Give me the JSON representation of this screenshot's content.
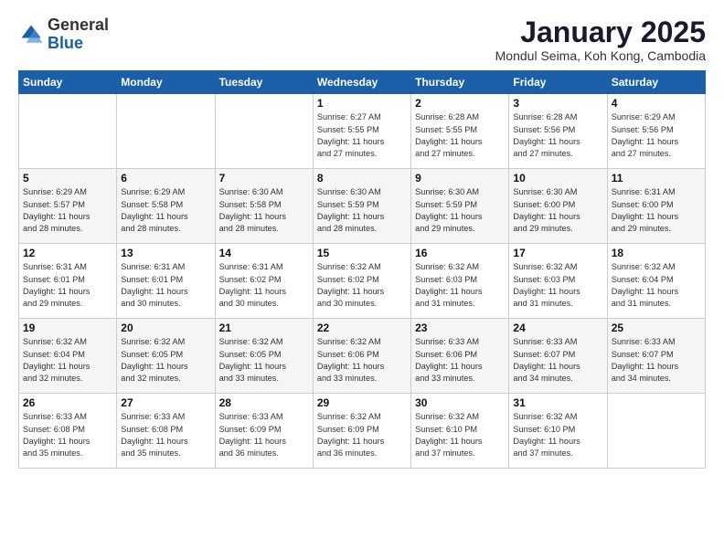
{
  "logo": {
    "line1": "General",
    "line2": "Blue"
  },
  "title": "January 2025",
  "location": "Mondul Seima, Koh Kong, Cambodia",
  "weekdays": [
    "Sunday",
    "Monday",
    "Tuesday",
    "Wednesday",
    "Thursday",
    "Friday",
    "Saturday"
  ],
  "weeks": [
    [
      {
        "day": "",
        "info": ""
      },
      {
        "day": "",
        "info": ""
      },
      {
        "day": "",
        "info": ""
      },
      {
        "day": "1",
        "info": "Sunrise: 6:27 AM\nSunset: 5:55 PM\nDaylight: 11 hours\nand 27 minutes."
      },
      {
        "day": "2",
        "info": "Sunrise: 6:28 AM\nSunset: 5:55 PM\nDaylight: 11 hours\nand 27 minutes."
      },
      {
        "day": "3",
        "info": "Sunrise: 6:28 AM\nSunset: 5:56 PM\nDaylight: 11 hours\nand 27 minutes."
      },
      {
        "day": "4",
        "info": "Sunrise: 6:29 AM\nSunset: 5:56 PM\nDaylight: 11 hours\nand 27 minutes."
      }
    ],
    [
      {
        "day": "5",
        "info": "Sunrise: 6:29 AM\nSunset: 5:57 PM\nDaylight: 11 hours\nand 28 minutes."
      },
      {
        "day": "6",
        "info": "Sunrise: 6:29 AM\nSunset: 5:58 PM\nDaylight: 11 hours\nand 28 minutes."
      },
      {
        "day": "7",
        "info": "Sunrise: 6:30 AM\nSunset: 5:58 PM\nDaylight: 11 hours\nand 28 minutes."
      },
      {
        "day": "8",
        "info": "Sunrise: 6:30 AM\nSunset: 5:59 PM\nDaylight: 11 hours\nand 28 minutes."
      },
      {
        "day": "9",
        "info": "Sunrise: 6:30 AM\nSunset: 5:59 PM\nDaylight: 11 hours\nand 29 minutes."
      },
      {
        "day": "10",
        "info": "Sunrise: 6:30 AM\nSunset: 6:00 PM\nDaylight: 11 hours\nand 29 minutes."
      },
      {
        "day": "11",
        "info": "Sunrise: 6:31 AM\nSunset: 6:00 PM\nDaylight: 11 hours\nand 29 minutes."
      }
    ],
    [
      {
        "day": "12",
        "info": "Sunrise: 6:31 AM\nSunset: 6:01 PM\nDaylight: 11 hours\nand 29 minutes."
      },
      {
        "day": "13",
        "info": "Sunrise: 6:31 AM\nSunset: 6:01 PM\nDaylight: 11 hours\nand 30 minutes."
      },
      {
        "day": "14",
        "info": "Sunrise: 6:31 AM\nSunset: 6:02 PM\nDaylight: 11 hours\nand 30 minutes."
      },
      {
        "day": "15",
        "info": "Sunrise: 6:32 AM\nSunset: 6:02 PM\nDaylight: 11 hours\nand 30 minutes."
      },
      {
        "day": "16",
        "info": "Sunrise: 6:32 AM\nSunset: 6:03 PM\nDaylight: 11 hours\nand 31 minutes."
      },
      {
        "day": "17",
        "info": "Sunrise: 6:32 AM\nSunset: 6:03 PM\nDaylight: 11 hours\nand 31 minutes."
      },
      {
        "day": "18",
        "info": "Sunrise: 6:32 AM\nSunset: 6:04 PM\nDaylight: 11 hours\nand 31 minutes."
      }
    ],
    [
      {
        "day": "19",
        "info": "Sunrise: 6:32 AM\nSunset: 6:04 PM\nDaylight: 11 hours\nand 32 minutes."
      },
      {
        "day": "20",
        "info": "Sunrise: 6:32 AM\nSunset: 6:05 PM\nDaylight: 11 hours\nand 32 minutes."
      },
      {
        "day": "21",
        "info": "Sunrise: 6:32 AM\nSunset: 6:05 PM\nDaylight: 11 hours\nand 33 minutes."
      },
      {
        "day": "22",
        "info": "Sunrise: 6:32 AM\nSunset: 6:06 PM\nDaylight: 11 hours\nand 33 minutes."
      },
      {
        "day": "23",
        "info": "Sunrise: 6:33 AM\nSunset: 6:06 PM\nDaylight: 11 hours\nand 33 minutes."
      },
      {
        "day": "24",
        "info": "Sunrise: 6:33 AM\nSunset: 6:07 PM\nDaylight: 11 hours\nand 34 minutes."
      },
      {
        "day": "25",
        "info": "Sunrise: 6:33 AM\nSunset: 6:07 PM\nDaylight: 11 hours\nand 34 minutes."
      }
    ],
    [
      {
        "day": "26",
        "info": "Sunrise: 6:33 AM\nSunset: 6:08 PM\nDaylight: 11 hours\nand 35 minutes."
      },
      {
        "day": "27",
        "info": "Sunrise: 6:33 AM\nSunset: 6:08 PM\nDaylight: 11 hours\nand 35 minutes."
      },
      {
        "day": "28",
        "info": "Sunrise: 6:33 AM\nSunset: 6:09 PM\nDaylight: 11 hours\nand 36 minutes."
      },
      {
        "day": "29",
        "info": "Sunrise: 6:32 AM\nSunset: 6:09 PM\nDaylight: 11 hours\nand 36 minutes."
      },
      {
        "day": "30",
        "info": "Sunrise: 6:32 AM\nSunset: 6:10 PM\nDaylight: 11 hours\nand 37 minutes."
      },
      {
        "day": "31",
        "info": "Sunrise: 6:32 AM\nSunset: 6:10 PM\nDaylight: 11 hours\nand 37 minutes."
      },
      {
        "day": "",
        "info": ""
      }
    ]
  ]
}
